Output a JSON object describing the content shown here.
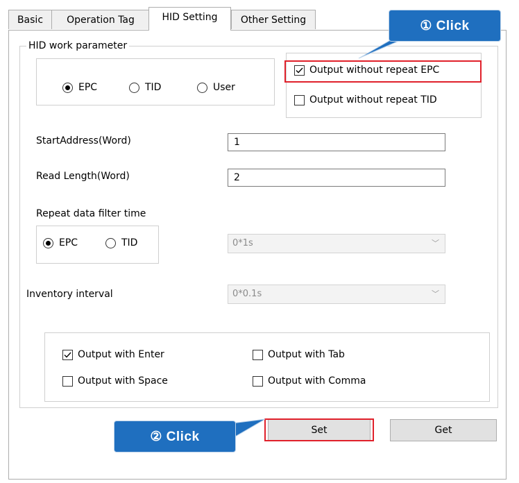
{
  "tabs": [
    "Basic",
    "Operation Tag",
    "HID Setting",
    "Other Setting"
  ],
  "active_tab": "HID Setting",
  "group_title": "HID work parameter",
  "mode_radios": [
    {
      "label": "EPC",
      "selected": true
    },
    {
      "label": "TID",
      "selected": false
    },
    {
      "label": "User",
      "selected": false
    }
  ],
  "repeat_checks": [
    {
      "label": "Output without repeat EPC",
      "checked": true
    },
    {
      "label": "Output without repeat TID",
      "checked": false
    }
  ],
  "start_address": {
    "label": "StartAddress(Word)",
    "value": "1"
  },
  "read_length": {
    "label": "Read Length(Word)",
    "value": "2"
  },
  "repeat_filter": {
    "label": "Repeat data filter time",
    "radios": [
      {
        "label": "EPC",
        "selected": true
      },
      {
        "label": "TID",
        "selected": false
      }
    ],
    "combo_value": "0*1s"
  },
  "inventory": {
    "label": "Inventory interval",
    "combo_value": "0*0.1s"
  },
  "output_checks": [
    {
      "label": "Output with Enter",
      "checked": true
    },
    {
      "label": "Output with Tab",
      "checked": false
    },
    {
      "label": "Output with Space",
      "checked": false
    },
    {
      "label": "Output with Comma",
      "checked": false
    }
  ],
  "buttons": {
    "set": "Set",
    "get": "Get"
  },
  "callouts": {
    "one": "① Click",
    "two": "② Click"
  },
  "colors": {
    "callout": "#1f6fbf",
    "highlight": "#e0202a"
  }
}
